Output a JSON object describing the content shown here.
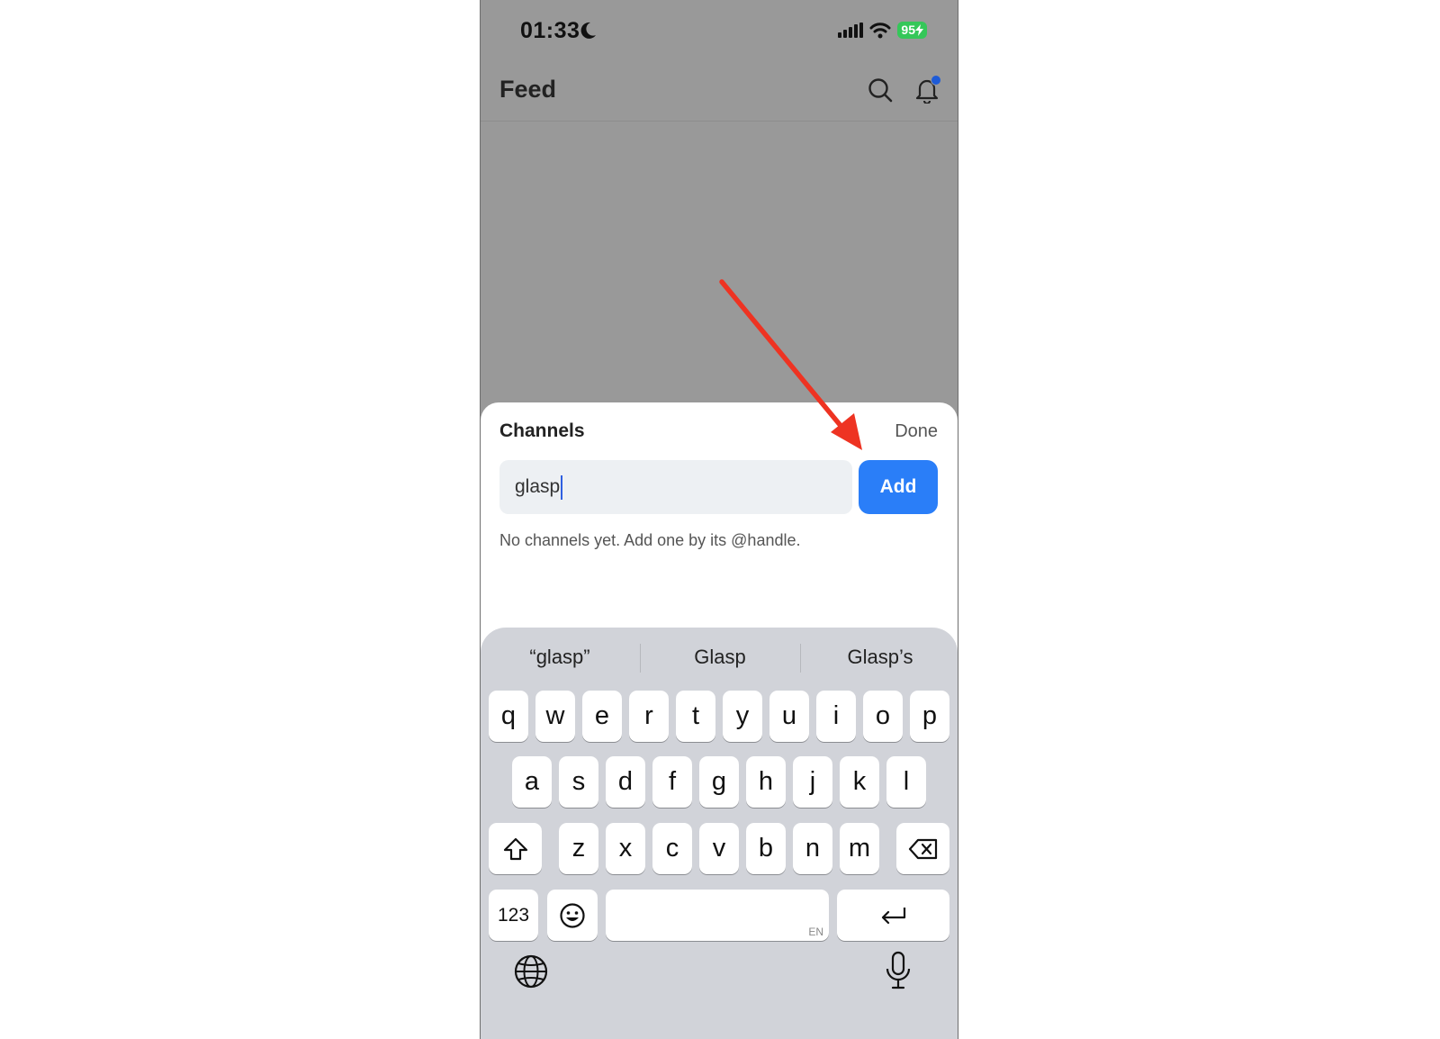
{
  "status_bar": {
    "time": "01:33",
    "battery": "95"
  },
  "header": {
    "title": "Feed"
  },
  "channels_sheet": {
    "title": "Channels",
    "done_label": "Done",
    "input_value": "glasp",
    "add_label": "Add",
    "empty_message": "No channels yet. Add one by its @handle."
  },
  "keyboard": {
    "suggestions": [
      "“glasp”",
      "Glasp",
      "Glasp’s"
    ],
    "row1": [
      "q",
      "w",
      "e",
      "r",
      "t",
      "y",
      "u",
      "i",
      "o",
      "p"
    ],
    "row2": [
      "a",
      "s",
      "d",
      "f",
      "g",
      "h",
      "j",
      "k",
      "l"
    ],
    "row3": [
      "z",
      "x",
      "c",
      "v",
      "b",
      "n",
      "m"
    ],
    "numbers_label": "123",
    "space_lang": "EN"
  },
  "colors": {
    "accent": "#2a7ef8",
    "annotation_arrow": "#ee3322",
    "battery": "#35c759"
  }
}
